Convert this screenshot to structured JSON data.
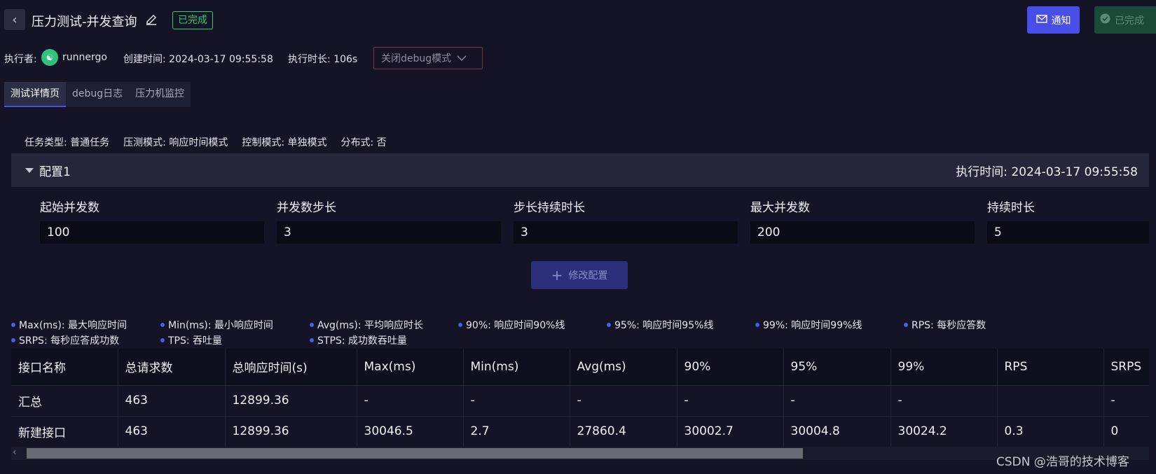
{
  "header": {
    "title": "压力测试-并发查询",
    "status": "已完成",
    "notify_label": "通知",
    "done_label": "已完成"
  },
  "meta": {
    "executor_label": "执行者:",
    "executor_name": "runnergo",
    "created": "创建时间: 2024-03-17 09:55:58",
    "duration": "执行时长: 106s",
    "debug_select": "关闭debug模式"
  },
  "tabs": [
    "测试详情页",
    "debug日志",
    "压力机监控"
  ],
  "info": [
    "任务类型: 普通任务",
    "压测模式: 响应时间模式",
    "控制模式: 单独模式",
    "分布式: 否"
  ],
  "config": {
    "title": "配置1",
    "exec_time": "执行时间: 2024-03-17 09:55:58",
    "fields": [
      {
        "label": "起始并发数",
        "value": "100"
      },
      {
        "label": "并发数步长",
        "value": "3"
      },
      {
        "label": "步长持续时长",
        "value": "3"
      },
      {
        "label": "最大并发数",
        "value": "200"
      },
      {
        "label": "持续时长",
        "value": "5"
      }
    ],
    "modify_label": "修改配置"
  },
  "legend": [
    "Max(ms): 最大响应时间",
    "Min(ms): 最小响应时间",
    "Avg(ms): 平均响应时长",
    "90%: 响应时间90%线",
    "95%: 响应时间95%线",
    "99%: 响应时间99%线",
    "RPS: 每秒应答数",
    "SRPS: 每秒应答成功数",
    "TPS: 吞吐量",
    "STPS: 成功数吞吐量"
  ],
  "table": {
    "headers": [
      "接口名称",
      "总请求数",
      "总响应时间(s)",
      "Max(ms)",
      "Min(ms)",
      "Avg(ms)",
      "90%",
      "95%",
      "99%",
      "RPS",
      "SRPS"
    ],
    "rows": [
      [
        "汇总",
        "463",
        "12899.36",
        "-",
        "-",
        "-",
        "-",
        "-",
        "-",
        "",
        "-"
      ],
      [
        "新建接口",
        "463",
        "12899.36",
        "30046.5",
        "2.7",
        "27860.4",
        "30002.7",
        "30004.8",
        "30024.2",
        "0.3",
        "0"
      ]
    ]
  },
  "watermark": "CSDN @浩哥的技术博客",
  "colors": {
    "accent": "#4a4ee8",
    "success": "#2ecc71",
    "background": "#141426"
  }
}
